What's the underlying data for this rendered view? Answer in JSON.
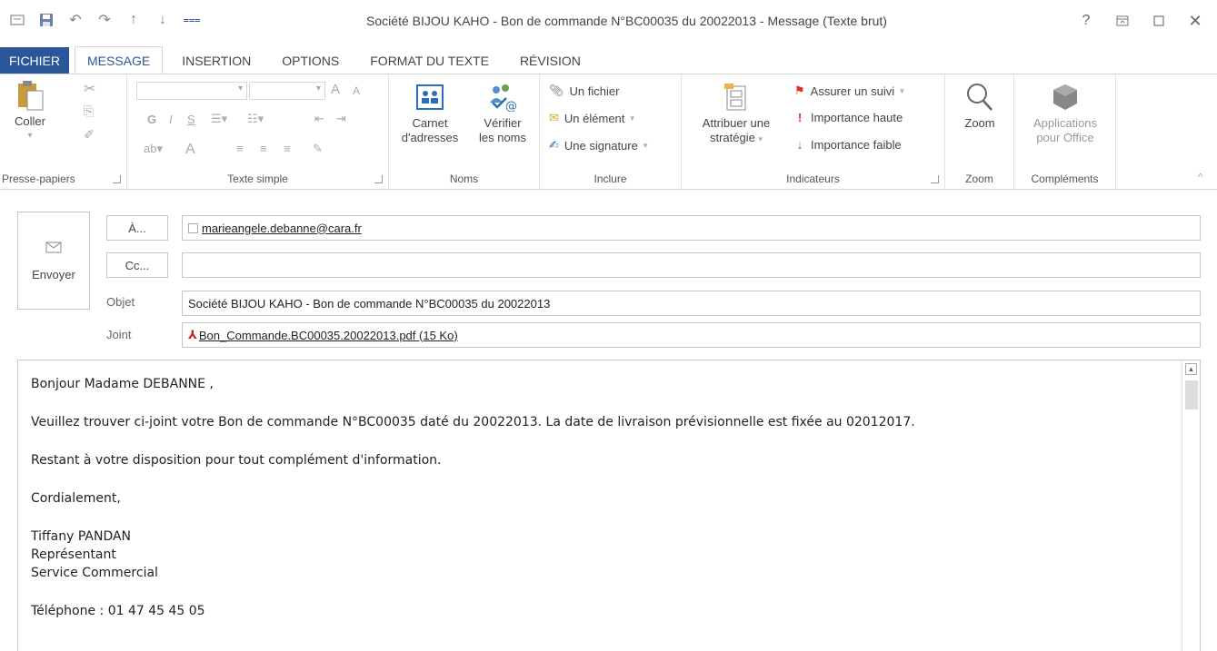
{
  "window": {
    "title": "Société BIJOU KAHO - Bon de commande N°BC00035 du 20022013 - Message (Texte brut)",
    "help": "?"
  },
  "tabs": [
    "FICHIER",
    "MESSAGE",
    "INSERTION",
    "OPTIONS",
    "FORMAT DU TEXTE",
    "RÉVISION"
  ],
  "ribbon": {
    "clipboard": {
      "paste": "Coller",
      "label": "Presse-papiers"
    },
    "basic_text": {
      "bold": "G",
      "italic": "I",
      "underline": "S",
      "grow": "A",
      "shrink": "A",
      "font_color": "A",
      "label": "Texte simple"
    },
    "names": {
      "address_book_line1": "Carnet",
      "address_book_line2": "d'adresses",
      "check_names_line1": "Vérifier",
      "check_names_line2": "les noms",
      "label": "Noms"
    },
    "include": {
      "file": "Un fichier",
      "item": "Un élément",
      "signature": "Une signature",
      "label": "Inclure"
    },
    "tags": {
      "policy_line1": "Attribuer une",
      "policy_line2": "stratégie",
      "follow_up": "Assurer un suivi",
      "high": "Importance haute",
      "low": "Importance faible",
      "label": "Indicateurs"
    },
    "zoom": {
      "button": "Zoom",
      "label": "Zoom"
    },
    "addins": {
      "apps_line1": "Applications",
      "apps_line2": "pour Office",
      "label": "Compléments"
    }
  },
  "compose": {
    "send": "Envoyer",
    "to_button": "À...",
    "cc_button": "Cc...",
    "subject_label": "Objet",
    "attached_label": "Joint",
    "to_value": "marieangele.debanne@cara.fr",
    "cc_value": "",
    "subject_value": "Société BIJOU KAHO - Bon de commande N°BC00035 du 20022013",
    "attachment": "Bon_Commande.BC00035.20022013.pdf (15 Ko)"
  },
  "body": {
    "greeting": "Bonjour Madame DEBANNE ,",
    "line1": "Veuillez trouver ci-joint votre Bon de commande N°BC00035 daté du 20022013. La date de livraison prévisionnelle est fixée au 02012017.",
    "line2": "Restant à votre disposition pour tout complément d'information.",
    "closing": "Cordialement,",
    "sig_name": "Tiffany PANDAN",
    "sig_title": "Représentant",
    "sig_dept": "Service Commercial",
    "phone": "Téléphone : 01 47 45 45 05"
  },
  "colors": {
    "accent": "#2b579a",
    "file_tab": "#2b579a"
  }
}
